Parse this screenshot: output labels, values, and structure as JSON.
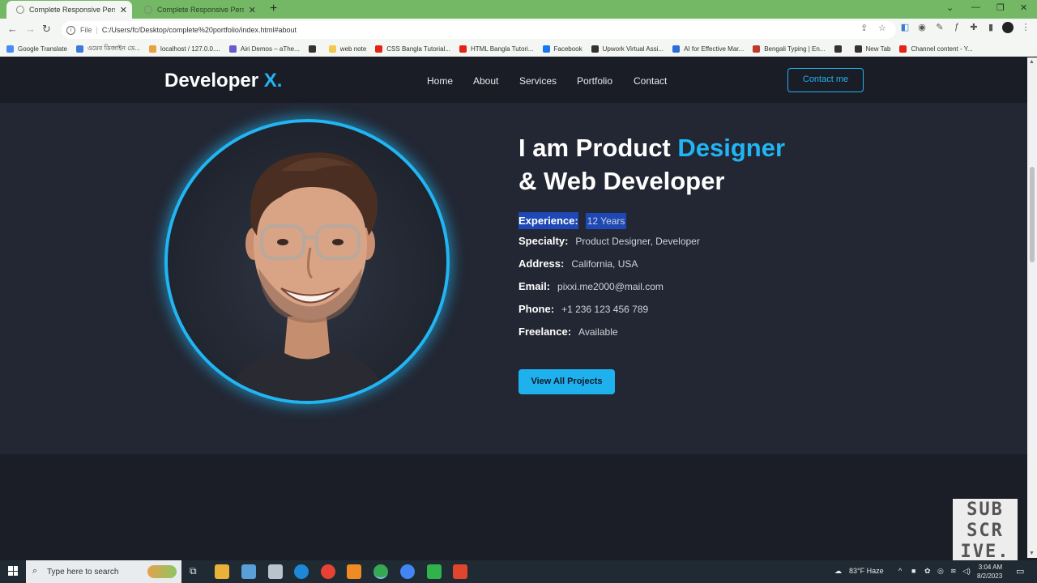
{
  "browser": {
    "tabs": [
      {
        "title": "Complete Responsive Personal P",
        "active": true
      },
      {
        "title": "Complete Responsive Personal P",
        "active": false
      }
    ],
    "address_prefix": "File",
    "url": "C:/Users/fc/Desktop/complete%20portfolio/index.html#about",
    "bookmarks": [
      {
        "label": "Google Translate",
        "color": "#4a8af4"
      },
      {
        "label": "ওয়েব ডিজাইন ডে...",
        "color": "#3b7bd8"
      },
      {
        "label": "localhost / 127.0.0....",
        "color": "#e6a23c"
      },
      {
        "label": "Airi Demos – aThe...",
        "color": "#6a5acd"
      },
      {
        "label": "",
        "color": "#333333"
      },
      {
        "label": "web note",
        "color": "#f2c94c"
      },
      {
        "label": "CSS Bangla Tutorial...",
        "color": "#e62117"
      },
      {
        "label": "HTML Bangla Tutori...",
        "color": "#e62117"
      },
      {
        "label": "Facebook",
        "color": "#1877f2"
      },
      {
        "label": "Upwork Virtual Assi...",
        "color": "#333333"
      },
      {
        "label": "AI for Effective Mar...",
        "color": "#2d6cdf"
      },
      {
        "label": "Bengali Typing | En...",
        "color": "#c0392b"
      },
      {
        "label": "",
        "color": "#333333"
      },
      {
        "label": "New Tab",
        "color": "#333333"
      },
      {
        "label": "Channel content - Y...",
        "color": "#e62117"
      }
    ]
  },
  "site": {
    "logo_text": "Developer",
    "logo_accent": "X.",
    "nav": [
      "Home",
      "About",
      "Services",
      "Portfolio",
      "Contact"
    ],
    "contact_button": "Contact me",
    "accent_color": "#21b5f3"
  },
  "about": {
    "headline_part1": "I am Product ",
    "headline_accent": "Designer",
    "headline_line2": "& Web Developer",
    "info": [
      {
        "label": "Experience:",
        "value": "12 Years",
        "selected": true
      },
      {
        "label": "Specialty:",
        "value": "Product Designer, Developer",
        "selected": false
      },
      {
        "label": "Address:",
        "value": "California, USA",
        "selected": false
      },
      {
        "label": "Email:",
        "value": "pixxi.me2000@mail.com",
        "selected": false
      },
      {
        "label": "Phone:",
        "value": "+1 236 123 456 789",
        "selected": false
      },
      {
        "label": "Freelance:",
        "value": "Available",
        "selected": false
      }
    ],
    "projects_button": "View All Projects"
  },
  "overlay": {
    "subscribe_lines": [
      "SUB",
      "SCR",
      "IVE."
    ]
  },
  "taskbar": {
    "search_placeholder": "Type here to search",
    "weather": "83°F  Haze",
    "time": "3:04 AM",
    "date": "8/2/2023"
  }
}
